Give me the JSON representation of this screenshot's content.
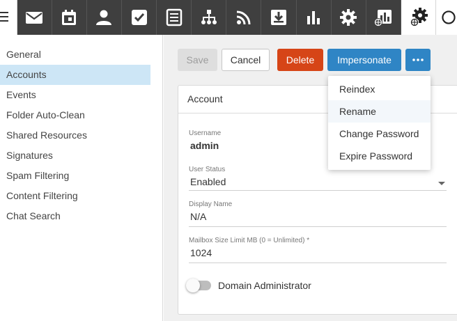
{
  "topbar": {
    "icons": [
      "menu-icon",
      "mail-icon",
      "calendar-icon",
      "contacts-icon",
      "tasks-icon",
      "notes-icon",
      "sitemap-icon",
      "rss-icon",
      "download-icon",
      "reports-icon",
      "settings-icon",
      "domain-reports-icon",
      "domain-settings-icon",
      "domain-overflow-icon"
    ],
    "active": "domain-settings-icon"
  },
  "sidebar": {
    "items": [
      {
        "label": "General"
      },
      {
        "label": "Accounts"
      },
      {
        "label": "Events"
      },
      {
        "label": "Folder Auto-Clean"
      },
      {
        "label": "Shared Resources"
      },
      {
        "label": "Signatures"
      },
      {
        "label": "Spam Filtering"
      },
      {
        "label": "Content Filtering"
      },
      {
        "label": "Chat Search"
      }
    ],
    "selected": "Accounts"
  },
  "toolbar": {
    "save_label": "Save",
    "cancel_label": "Cancel",
    "delete_label": "Delete",
    "impersonate_label": "Impersonate",
    "more_label": "•••"
  },
  "dropdown": {
    "items": [
      "Reindex",
      "Rename",
      "Change Password",
      "Expire Password"
    ],
    "hovered": "Rename"
  },
  "account": {
    "header": "Account",
    "username_label": "Username",
    "username_value": "admin",
    "status_label": "User Status",
    "status_value": "Enabled",
    "display_name_label": "Display Name",
    "display_name_value": "N/A",
    "mailbox_label": "Mailbox Size Limit MB (0 = Unlimited) *",
    "mailbox_value": "1024",
    "domain_admin_label": "Domain Administrator",
    "domain_admin_enabled": false
  },
  "colors": {
    "topbar": "#3f3f3f",
    "selected_row": "#cde6f6",
    "primary": "#2f85c5",
    "danger": "#d64517"
  }
}
